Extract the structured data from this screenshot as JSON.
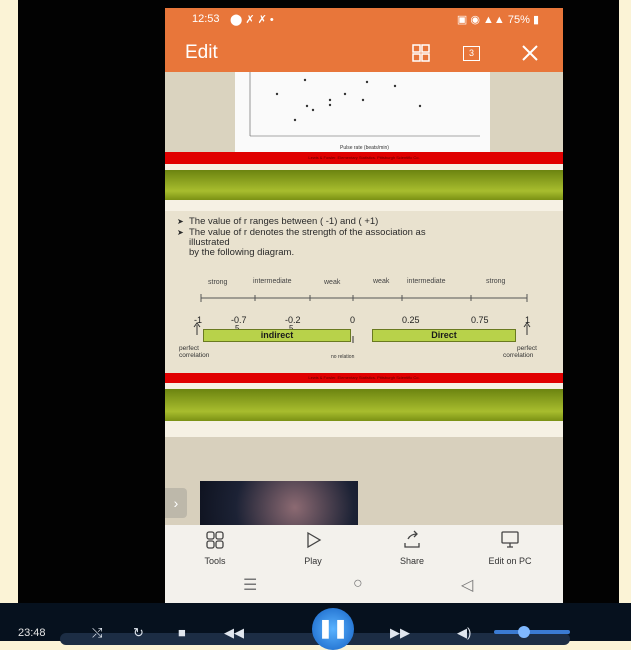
{
  "status": {
    "time": "12:53",
    "battery": "75%"
  },
  "appbar": {
    "title": "Edit",
    "page_count": "3"
  },
  "plot": {
    "xlabel": "Pulse rate (beats/min)"
  },
  "band_caption": "Lewis & Fowler. Elementary Statistics. Pittsburgh Scientific Co.",
  "slide": {
    "bullets": [
      "The value of r ranges between ( -1) and ( +1)",
      "The value of r denotes the strength of the association as",
      "illustrated",
      "by the following diagram."
    ],
    "scale_labels": [
      "strong",
      "intermediate",
      "weak",
      "weak",
      "intermediate",
      "strong"
    ],
    "ticks": [
      "-1",
      "-0.7",
      "-0.2",
      "0",
      "0.25",
      "0.75",
      "1"
    ],
    "tick_sub": [
      "5",
      "5"
    ],
    "indirect": "indirect",
    "direct": "Direct",
    "perfect_left": [
      "perfect",
      "correlation"
    ],
    "no_relation": "no relation",
    "perfect_right": [
      "perfect",
      "correlation"
    ]
  },
  "toolbar": {
    "tools": "Tools",
    "play": "Play",
    "share": "Share",
    "edit_pc": "Edit on PC"
  },
  "player": {
    "time": "23:48"
  }
}
